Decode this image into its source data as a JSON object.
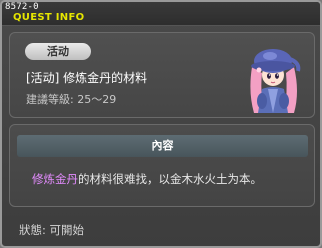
{
  "window": {
    "id": "8572-0",
    "title": "QUEST INFO"
  },
  "quest": {
    "category": "活动",
    "name": "[活动] 修炼金丹的材料",
    "level": "建議等級: 25～29"
  },
  "content": {
    "header": "內容",
    "description_highlight": "修炼金丹",
    "description_rest": "的材料很难找，以金木水火土为本。"
  },
  "status": "狀態: 可開始",
  "colors": {
    "title": "#e6e600",
    "highlight": "#e48cff"
  },
  "icons": {
    "npc": "npc-portrait-girl-with-pink-hair"
  }
}
